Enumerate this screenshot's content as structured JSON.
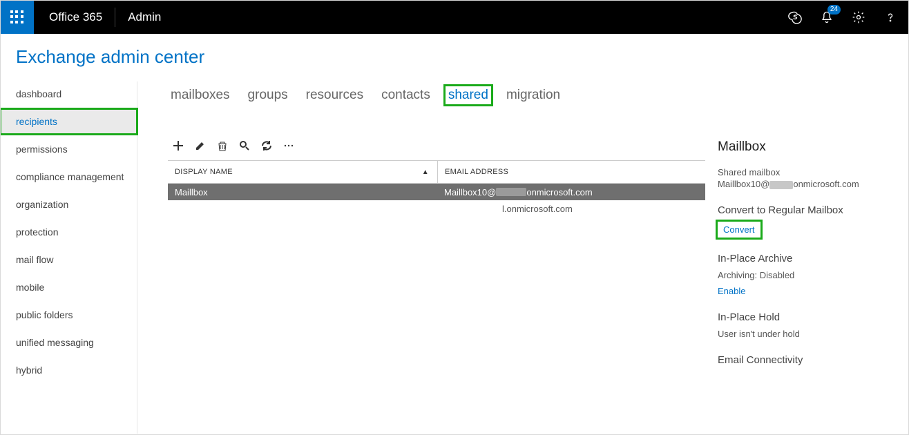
{
  "topbar": {
    "product": "Office 365",
    "area": "Admin",
    "notification_count": "24"
  },
  "page_title": "Exchange admin center",
  "sidebar": {
    "items": [
      {
        "label": "dashboard"
      },
      {
        "label": "recipients",
        "active": true
      },
      {
        "label": "permissions"
      },
      {
        "label": "compliance management"
      },
      {
        "label": "organization"
      },
      {
        "label": "protection"
      },
      {
        "label": "mail flow"
      },
      {
        "label": "mobile"
      },
      {
        "label": "public folders"
      },
      {
        "label": "unified messaging"
      },
      {
        "label": "hybrid"
      }
    ]
  },
  "tabs": [
    {
      "label": "mailboxes"
    },
    {
      "label": "groups"
    },
    {
      "label": "resources"
    },
    {
      "label": "contacts"
    },
    {
      "label": "shared",
      "active": true
    },
    {
      "label": "migration"
    }
  ],
  "grid": {
    "headers": {
      "name": "DISPLAY NAME",
      "email": "EMAIL ADDRESS"
    },
    "rows": [
      {
        "name": "Maillbox",
        "email_pre": "Maillbox10@",
        "email_post": "onmicrosoft.com",
        "selected": true
      },
      {
        "name": "",
        "email_pre": "",
        "email_post": "l.onmicrosoft.com",
        "selected": false
      }
    ]
  },
  "details": {
    "title": "Maillbox",
    "type": "Shared mailbox",
    "email_pre": "Maillbox10@",
    "email_post": "onmicrosoft.com",
    "convert_heading": "Convert to Regular Mailbox",
    "convert_link": "Convert",
    "archive_heading": "In-Place Archive",
    "archive_status": "Archiving:  Disabled",
    "archive_link": "Enable",
    "hold_heading": "In-Place Hold",
    "hold_status": "User isn't under hold",
    "connectivity_heading": "Email Connectivity"
  }
}
